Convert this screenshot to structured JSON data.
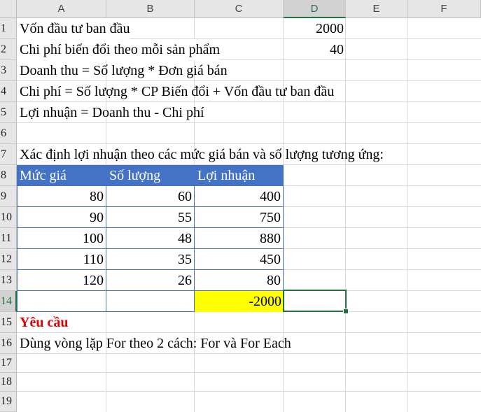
{
  "columns": [
    "A",
    "B",
    "C",
    "D",
    "E",
    "F"
  ],
  "rows": [
    "1",
    "2",
    "3",
    "4",
    "5",
    "6",
    "7",
    "8",
    "9",
    "10",
    "11",
    "12",
    "13",
    "14",
    "15",
    "16",
    "17",
    "18",
    "19"
  ],
  "selected_cell": "D14",
  "colors": {
    "header_fill": "#4472c4",
    "highlight": "#ffff00",
    "accent": "#217346",
    "red_text": "#e00000"
  },
  "cells": {
    "A1": "Vốn đầu tư ban đầu",
    "D1": "2000",
    "A2": "Chi phí biến đổi theo mỗi sản phẩm",
    "D2": "40",
    "A3": "Doanh thu = Số lượng * Đơn giá bán",
    "A4": "Chi phí = Số lượng * CP Biến đổi + Vốn đầu tư ban đầu",
    "A5": "Lợi nhuận = Doanh thu - Chi phí",
    "A7": "Xác định lợi nhuận theo các mức giá bán và số lượng tương ứng:",
    "A14_C14": "-2000",
    "A15": "Yêu cầu",
    "A16": "Dùng vòng lặp For theo 2 cách: For và For Each"
  },
  "table": {
    "headers": [
      "Mức giá",
      "Số lượng",
      "Lợi nhuận"
    ],
    "rows": [
      [
        "80",
        "60",
        "400"
      ],
      [
        "90",
        "55",
        "750"
      ],
      [
        "100",
        "48",
        "880"
      ],
      [
        "110",
        "35",
        "450"
      ],
      [
        "120",
        "26",
        "80"
      ]
    ]
  }
}
